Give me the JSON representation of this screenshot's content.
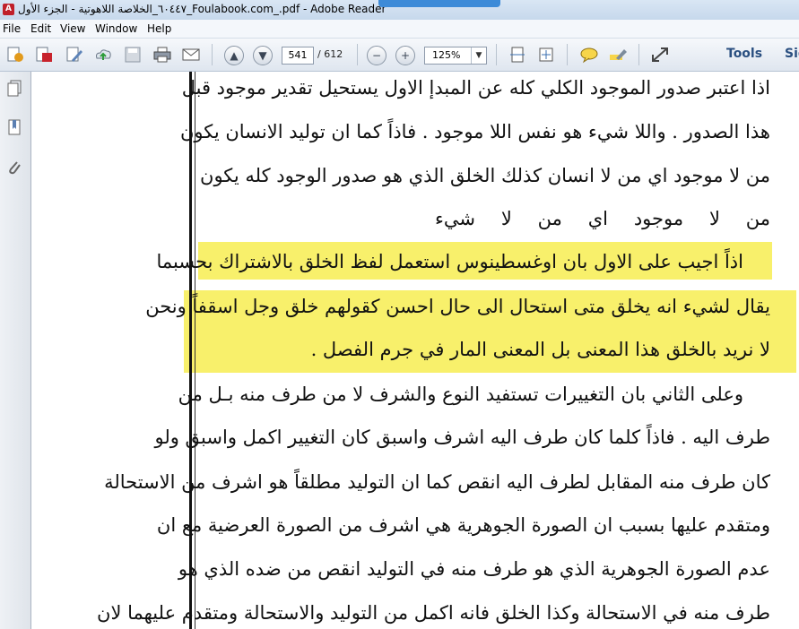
{
  "window": {
    "title": "٦٠٤٤٧_الخلاصة اللاهوتية - الجزء الأول_Foulabook.com_.pdf - Adobe Reader"
  },
  "menu": {
    "items": [
      "File",
      "Edit",
      "View",
      "Window",
      "Help"
    ]
  },
  "toolbar": {
    "icons": [
      "create-icon",
      "convert-icon",
      "edit-icon",
      "upload-icon",
      "save-icon",
      "print-icon",
      "email-icon",
      "previous-page-icon",
      "next-page-icon",
      "zoom-out-icon",
      "zoom-in-icon",
      "fit-page-icon",
      "fit-width-icon",
      "comment-icon",
      "highlight-icon",
      "fullscreen-icon"
    ],
    "current_page": "541",
    "total_pages": "/ 612",
    "zoom": "125%",
    "tools_label": "Tools",
    "sign_label": "Sig"
  },
  "left_panel": {
    "icons": [
      "pages-icon",
      "bookmarks-icon",
      "attachments-icon"
    ]
  },
  "document": {
    "lines": [
      "اذا اعتبر صدور الموجود الكلي كله عن المبدإ الاول يستحيل تقدير موجود قبل",
      "هذا الصدور . واللا شيء هو نفس اللا موجود . فاذاً كما ان توليد الانسان يكون",
      "من لا موجود اي من لا انسان كذلك الخلق الذي هو صدور الوجود كله يكون",
      "من لا موجود اي من لا شيء",
      "اذاً اجيب على الاول بان اوغسطينوس استعمل لفظ الخلق بالاشتراك بحسبما",
      "يقال لشيء انه يخلق متى استحال الى حال احسن كقولهم خلق وجل اسقفاً ونحن",
      "لا نريد بالخلق هذا المعنى بل المعنى المار في جرم الفصل .",
      "وعلى الثاني بان التغييرات تستفيد النوع والشرف لا من طرف منه بـل من",
      "طرف اليه . فاذاً كلما كان طرف اليه اشرف واسبق كان التغيير اكمل واسبق ولو",
      "كان طرف منه المقابل لطرف اليه انقص كما ان التوليد مطلقاً هو اشرف من الاستحالة",
      "ومتقدم عليها بسبب ان الصورة الجوهرية هي اشرف من الصورة العرضية مع ان",
      "عدم الصورة الجوهرية الذي هو طرف منه في التوليد انقص من ضده الذي هو",
      "طرف منه في الاستحالة وكذا الخلق فانه اكمل من التوليد والاستحالة ومتقدم عليهما لان"
    ],
    "highlight_color": "#f8f06b"
  }
}
